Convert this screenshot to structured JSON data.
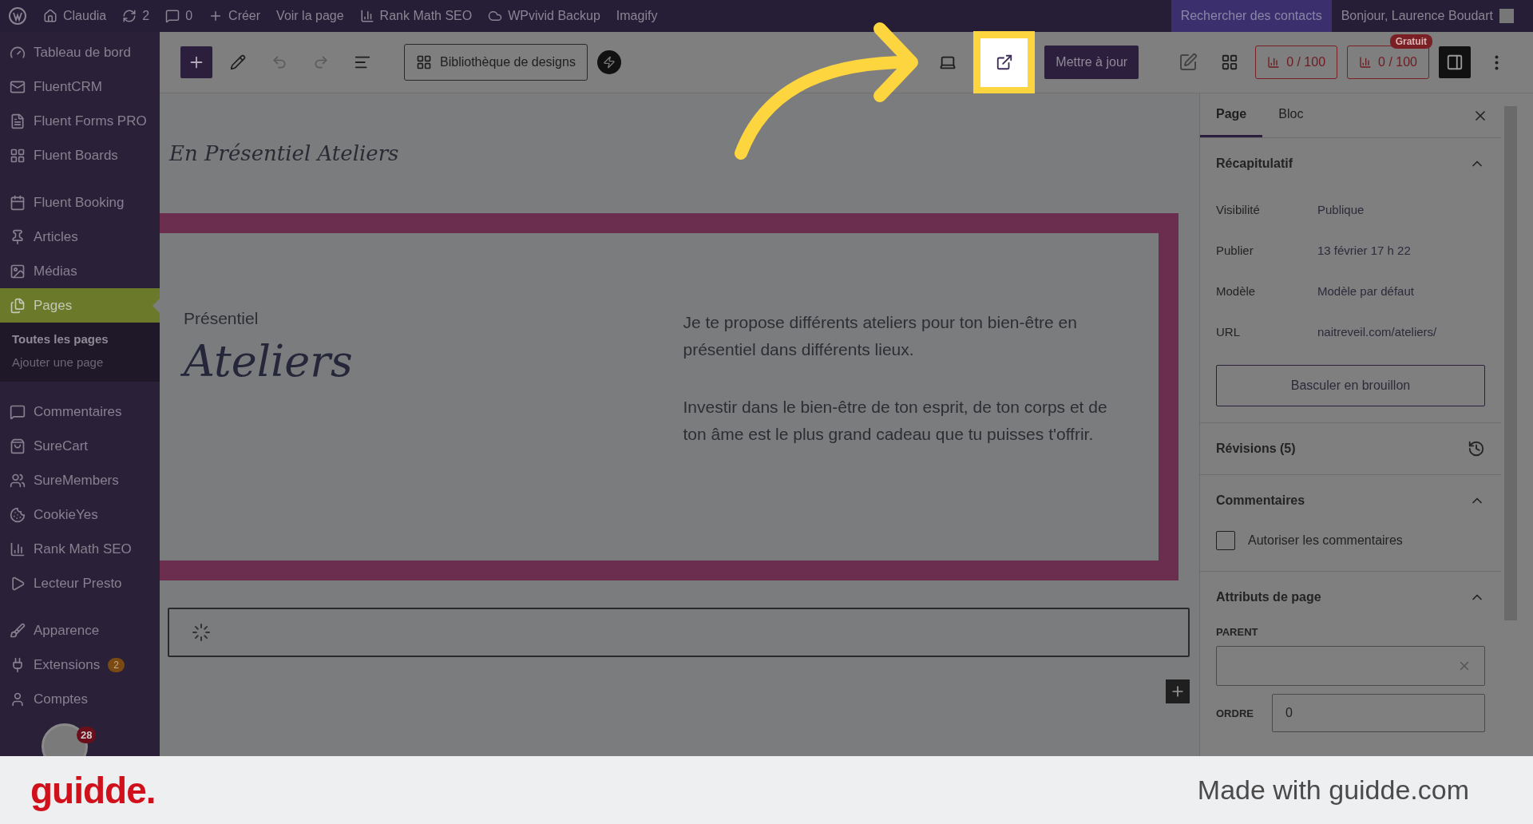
{
  "admin_bar": {
    "site": "Claudia",
    "updates": "2",
    "comments": "0",
    "items": [
      "Créer",
      "Voir la page",
      "Rank Math SEO",
      "WPvivid Backup",
      "Imagify"
    ],
    "search_contacts": "Rechercher des contacts",
    "greeting": "Bonjour, Laurence Boudart"
  },
  "sidebar": {
    "items": [
      {
        "label": "Tableau de bord",
        "selected": false
      },
      {
        "label": "FluentCRM",
        "selected": false
      },
      {
        "label": "Fluent Forms PRO",
        "selected": false
      },
      {
        "label": "Fluent Boards",
        "selected": false
      },
      {
        "label": "Fluent Booking",
        "selected": false
      },
      {
        "label": "Articles",
        "selected": false
      },
      {
        "label": "Médias",
        "selected": false
      },
      {
        "label": "Pages",
        "selected": true,
        "children": [
          {
            "label": "Toutes les pages",
            "selected": true
          },
          {
            "label": "Ajouter une page",
            "selected": false
          }
        ]
      },
      {
        "label": "Commentaires",
        "selected": false
      },
      {
        "label": "SureCart",
        "selected": false
      },
      {
        "label": "SureMembers",
        "selected": false
      },
      {
        "label": "CookieYes",
        "selected": false
      },
      {
        "label": "Rank Math SEO",
        "selected": false
      },
      {
        "label": "Lecteur Presto",
        "selected": false
      },
      {
        "label": "Apparence",
        "selected": false
      },
      {
        "label": "Extensions",
        "selected": false,
        "badge": "2"
      },
      {
        "label": "Comptes",
        "selected": false
      }
    ],
    "avatar_badge": "28"
  },
  "toolbar": {
    "design_library": "Bibliothèque de designs",
    "update": "Mettre à jour",
    "scores": [
      {
        "label": "0 / 100"
      },
      {
        "label": "0 / 100",
        "badge": "Gratuit"
      }
    ]
  },
  "canvas": {
    "site_title": "En Présentiel Ateliers",
    "eyebrow": "Présentiel",
    "heading": "Ateliers",
    "paragraphs": [
      "Je te propose différents ateliers pour ton bien-être en présentiel dans différents lieux.",
      "Investir dans le bien-être de ton esprit, de ton corps et de ton âme est le plus grand cadeau que tu puisses t'offrir."
    ]
  },
  "panel": {
    "tabs": [
      {
        "label": "Page",
        "selected": true
      },
      {
        "label": "Bloc",
        "selected": false
      }
    ],
    "summary": {
      "title": "Récapitulatif",
      "expanded": true,
      "rows": [
        {
          "label": "Visibilité",
          "value": "Publique"
        },
        {
          "label": "Publier",
          "value": "13 février 17 h 22"
        },
        {
          "label": "Modèle",
          "value": "Modèle par défaut"
        },
        {
          "label": "URL",
          "value": "naitreveil.com/ateliers/"
        }
      ],
      "button": "Basculer en brouillon"
    },
    "revisions": "Révisions (5)",
    "comments": {
      "title": "Commentaires",
      "expanded": true,
      "checkbox": {
        "label": "Autoriser les commentaires",
        "checked": false
      }
    },
    "attributes": {
      "title": "Attributs de page",
      "expanded": true,
      "parent_label": "PARENT",
      "order_label": "ORDRE",
      "order_value": "0"
    }
  },
  "footer": {
    "brand": "guidde.",
    "tagline": "Made with guidde.com"
  }
}
